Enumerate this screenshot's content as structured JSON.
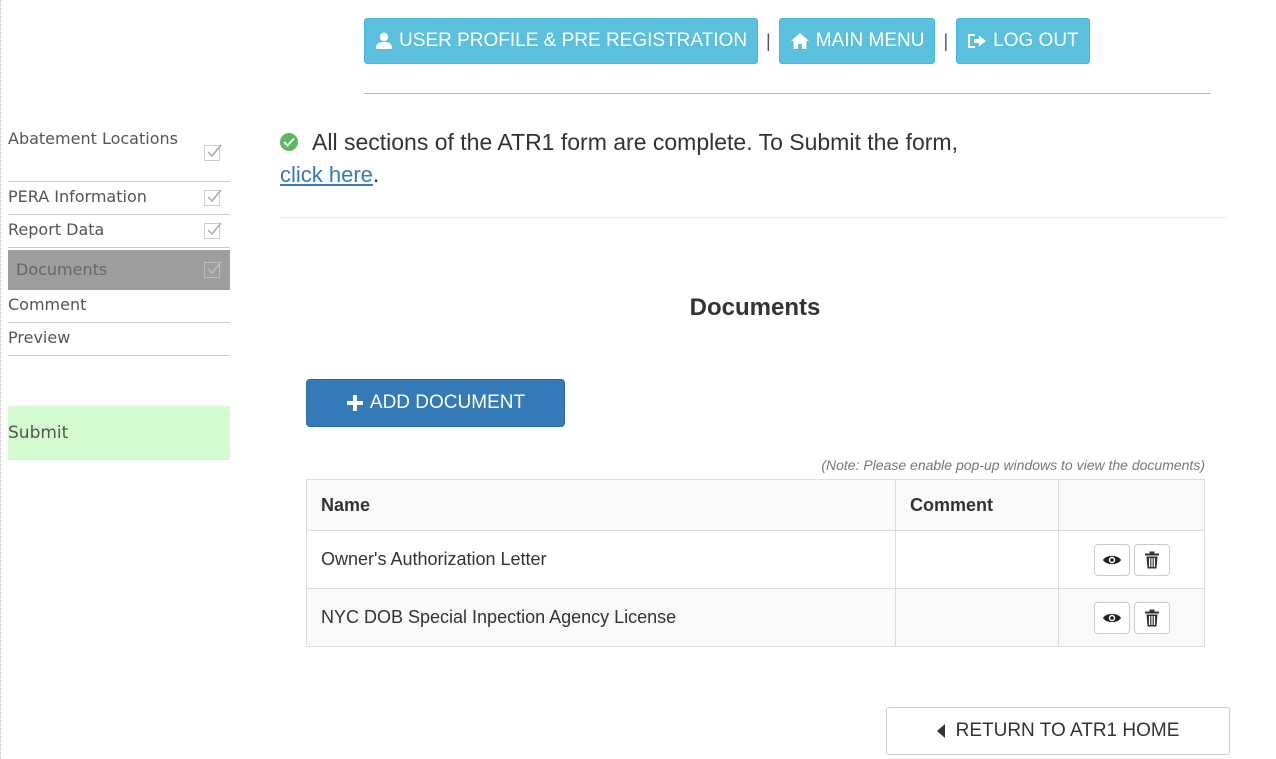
{
  "topnav": {
    "profile_label": "USER PROFILE & PRE REGISTRATION",
    "separator": "|",
    "main_menu_label": "MAIN MENU",
    "logout_label": "LOG OUT",
    "color": "#5bc0de"
  },
  "sidebar": {
    "items": [
      {
        "label": "Abatement Locations",
        "checked": true
      },
      {
        "label": "PERA Information",
        "checked": true
      },
      {
        "label": "Report Data",
        "checked": true
      },
      {
        "label": "Documents",
        "checked": false,
        "active": true
      },
      {
        "label": "Comment"
      },
      {
        "label": "Preview"
      }
    ],
    "submit_label": "Submit"
  },
  "status": {
    "message": "All sections of the ATR1 form are complete. To Submit the form,",
    "link_text": "click here",
    "trailing": "."
  },
  "documents": {
    "title": "Documents",
    "add_button": "ADD DOCUMENT",
    "note": "(Note: Please enable pop-up windows to view the documents)",
    "columns": [
      "Name",
      "Comment",
      ""
    ],
    "rows": [
      {
        "name": "Owner's Authorization Letter",
        "comment": ""
      },
      {
        "name": "NYC DOB Special Inpection Agency License",
        "comment": ""
      }
    ]
  },
  "footer": {
    "return_label": "RETURN TO ATR1 HOME"
  },
  "colors": {
    "primary": "#337ab7",
    "info": "#5bc0de",
    "success": "#5cb85c",
    "submit_bg": "#d4fad0",
    "active_bg": "#9e9e9e"
  }
}
